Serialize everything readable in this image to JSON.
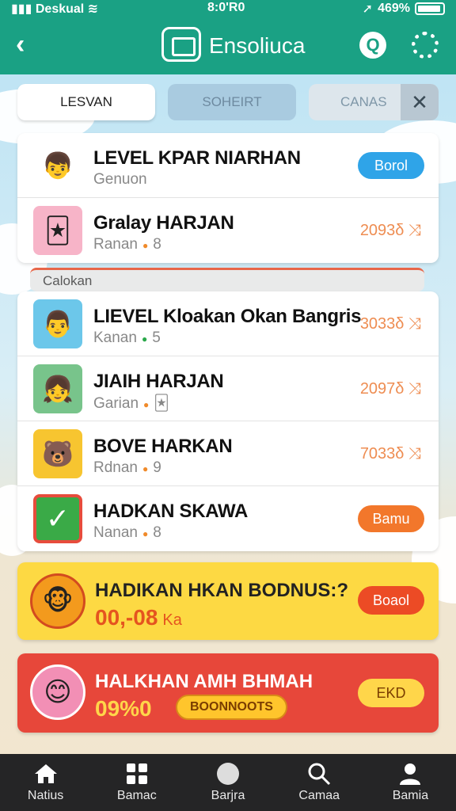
{
  "status_bar": {
    "carrier": "Deskual",
    "time": "8:0'R0",
    "battery": "469%"
  },
  "header": {
    "title": "Ensoliuca"
  },
  "tabs": [
    {
      "label": "LESVAN"
    },
    {
      "label": "SOHEIRT"
    },
    {
      "label": "CANAS"
    }
  ],
  "list_top": [
    {
      "title": "LEVEL KPAR NIARHAN",
      "sub": "Genuon",
      "action": "Borol",
      "action_color": "blue",
      "avatar": "boy-avatar-icon"
    },
    {
      "title": "Gralay HARJAN",
      "sub": "Ranan",
      "sub_extra": "8",
      "score": "2093δ ⤨",
      "avatar": "game-card-icon"
    }
  ],
  "section_label": "Calokan",
  "list_main": [
    {
      "title": "LIEVEL Kloakan Okan Bangris",
      "sub": "Kanan",
      "sub_extra": "5",
      "score": "3033δ ⤨",
      "avatar": "man-avatar-icon"
    },
    {
      "title": "JIAIH HARJAN",
      "sub": "Garian",
      "sub_extra": "🃏",
      "score": "2097δ ⤨",
      "avatar": "girl-avatar-icon"
    },
    {
      "title": "BOVE HARKAN",
      "sub": "Rdnan",
      "sub_extra": "9",
      "score": "7033δ ⤨",
      "avatar": "bear-avatar-icon"
    },
    {
      "title": "HADKAN SKAWA",
      "sub": "Nanan",
      "sub_extra": "8",
      "action": "Bamu",
      "action_color": "orange",
      "avatar": "check-icon"
    }
  ],
  "banners": [
    {
      "title": "HADIKAN HKAN BODNUS:?",
      "value": "00,-08",
      "value_suffix": "Ka",
      "button": "Boaol"
    },
    {
      "title": "HALKHAN AMH BHMAH",
      "value": "09%0",
      "chip": "BOONNOOTS",
      "button": "EKD"
    }
  ],
  "bottom_nav": [
    {
      "label": "Natius",
      "icon": "home-icon"
    },
    {
      "label": "Bamac",
      "icon": "grid-icon"
    },
    {
      "label": "Barjra",
      "icon": "circle-icon"
    },
    {
      "label": "Camaa",
      "icon": "search-icon"
    },
    {
      "label": "Bamia",
      "icon": "profile-icon"
    }
  ],
  "colors": {
    "header": "#1aa184",
    "accent_blue": "#2fa4e8",
    "accent_orange": "#f2772b",
    "banner_yellow": "#fdd943",
    "banner_red": "#e7473a",
    "nav": "#252526"
  }
}
